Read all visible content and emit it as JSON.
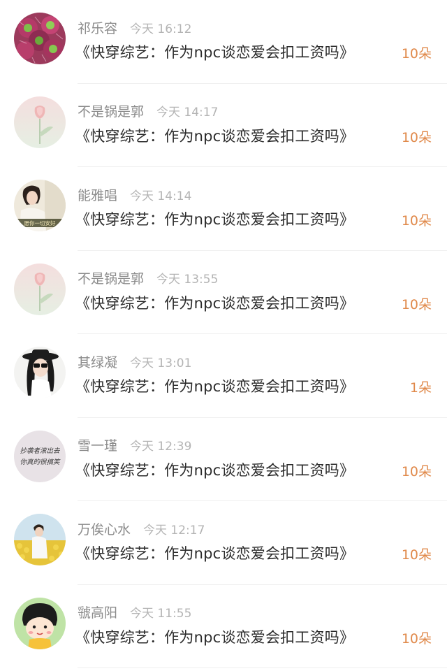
{
  "items": [
    {
      "name": "祁乐容",
      "time": "今天 16:12",
      "title": "《快穿综艺：作为npc谈恋爱会扣工资吗》",
      "count": "10朵",
      "avatar": "fruit-avatar"
    },
    {
      "name": "不是锅是郭",
      "time": "今天 14:17",
      "title": "《快穿综艺：作为npc谈恋爱会扣工资吗》",
      "count": "10朵",
      "avatar": "tulip-avatar"
    },
    {
      "name": "能雅唱",
      "time": "今天 14:14",
      "title": "《快穿综艺：作为npc谈恋爱会扣工资吗》",
      "count": "10朵",
      "avatar": "girl-photo-avatar"
    },
    {
      "name": "不是锅是郭",
      "time": "今天 13:55",
      "title": "《快穿综艺：作为npc谈恋爱会扣工资吗》",
      "count": "10朵",
      "avatar": "tulip-avatar"
    },
    {
      "name": "其绿凝",
      "time": "今天 13:01",
      "title": "《快穿综艺：作为npc谈恋爱会扣工资吗》",
      "count": "1朵",
      "avatar": "hat-girl-avatar"
    },
    {
      "name": "雪一瑾",
      "time": "今天 12:39",
      "title": "《快穿综艺：作为npc谈恋爱会扣工资吗》",
      "count": "10朵",
      "avatar": "handwriting-avatar"
    },
    {
      "name": "万俟心水",
      "time": "今天 12:17",
      "title": "《快穿综艺：作为npc谈恋爱会扣工资吗》",
      "count": "10朵",
      "avatar": "flower-field-avatar"
    },
    {
      "name": "虢高阳",
      "time": "今天 11:55",
      "title": "《快穿综艺：作为npc谈恋爱会扣工资吗》",
      "count": "10朵",
      "avatar": "cartoon-avatar"
    }
  ],
  "avatar_texts": {
    "girl_photo_caption": "愿你一切安好",
    "handwriting_line1": "抄袭者滚出去",
    "handwriting_line2": "你真的很搞笑"
  },
  "colors": {
    "count": "#e0894a",
    "name": "#8b8b8b",
    "time": "#b4b4b4",
    "title": "#2b2b2b",
    "divider": "#efefef"
  }
}
